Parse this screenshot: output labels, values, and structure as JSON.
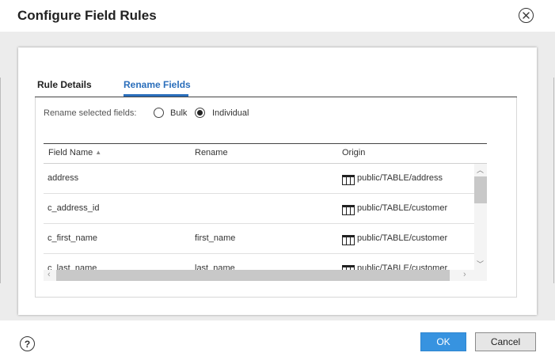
{
  "dialog": {
    "title": "Configure Field Rules"
  },
  "tabs": [
    {
      "label": "Rule Details",
      "active": false
    },
    {
      "label": "Rename Fields",
      "active": true
    }
  ],
  "rename": {
    "label": "Rename selected fields:",
    "options": [
      {
        "label": "Bulk",
        "selected": false
      },
      {
        "label": "Individual",
        "selected": true
      }
    ]
  },
  "grid": {
    "columns": [
      "Field Name",
      "Rename",
      "Origin"
    ],
    "sort": {
      "column": "Field Name",
      "direction": "ascending"
    },
    "rows": [
      {
        "field_name": "address",
        "rename": "",
        "origin": "public/TABLE/address"
      },
      {
        "field_name": "c_address_id",
        "rename": "",
        "origin": "public/TABLE/customer"
      },
      {
        "field_name": "c_first_name",
        "rename": "first_name",
        "origin": "public/TABLE/customer"
      },
      {
        "field_name": "c_last_name",
        "rename": "last_name",
        "origin": "public/TABLE/customer"
      }
    ]
  },
  "footer": {
    "ok_label": "OK",
    "cancel_label": "Cancel"
  },
  "colors": {
    "accent": "#2a6ebb",
    "ok_button": "#3793e0",
    "body_bg": "#ececec"
  }
}
